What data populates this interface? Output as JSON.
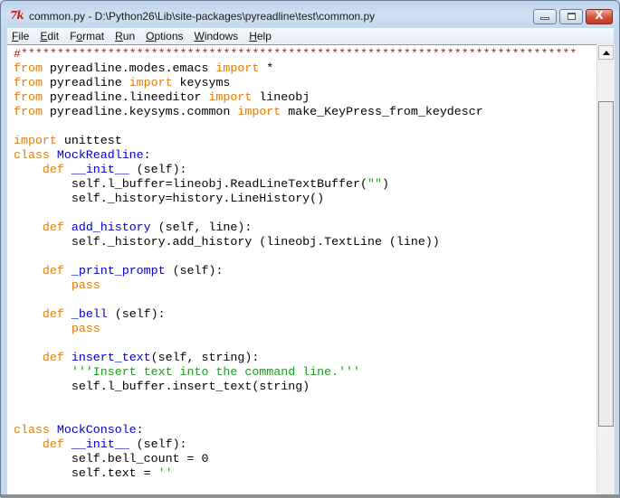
{
  "window": {
    "title": "common.py - D:\\Python26\\Lib\\site-packages\\pyreadline\\test\\common.py",
    "app_icon": "tk-feather-icon",
    "app_icon_text": "7k",
    "controls": {
      "minimize": "minimize-icon",
      "maximize": "maximize-icon",
      "close": "close-icon",
      "close_glyph": "X"
    }
  },
  "menubar": [
    {
      "label": "File",
      "mnemonic": "F",
      "rest": "ile"
    },
    {
      "label": "Edit",
      "mnemonic": "E",
      "rest": "dit"
    },
    {
      "label": "Format",
      "pre": "F",
      "mnemonic": "o",
      "rest": "rmat"
    },
    {
      "label": "Run",
      "mnemonic": "R",
      "rest": "un"
    },
    {
      "label": "Options",
      "mnemonic": "O",
      "rest": "ptions"
    },
    {
      "label": "Windows",
      "mnemonic": "W",
      "rest": "indows"
    },
    {
      "label": "Help",
      "mnemonic": "H",
      "rest": "elp"
    }
  ],
  "syntax_colors": {
    "keyword": "#e07d10",
    "definition": "#0000c8",
    "string": "#1e9b1e",
    "comment": "#c01818",
    "text": "#000000"
  },
  "editor": {
    "lines": [
      [
        [
          "cmt",
          "#*****************************************************************************"
        ]
      ],
      [
        [
          "kw",
          "from"
        ],
        [
          "",
          " pyreadline.modes.emacs "
        ],
        [
          "kw",
          "import"
        ],
        [
          "",
          " *"
        ]
      ],
      [
        [
          "kw",
          "from"
        ],
        [
          "",
          " pyreadline "
        ],
        [
          "kw",
          "import"
        ],
        [
          "",
          " keysyms"
        ]
      ],
      [
        [
          "kw",
          "from"
        ],
        [
          "",
          " pyreadline.lineeditor "
        ],
        [
          "kw",
          "import"
        ],
        [
          "",
          " lineobj"
        ]
      ],
      [
        [
          "kw",
          "from"
        ],
        [
          "",
          " pyreadline.keysyms.common "
        ],
        [
          "kw",
          "import"
        ],
        [
          "",
          " make_KeyPress_from_keydescr"
        ]
      ],
      [
        [
          "",
          ""
        ]
      ],
      [
        [
          "kw",
          "import"
        ],
        [
          "",
          " unittest"
        ]
      ],
      [
        [
          "kw",
          "class"
        ],
        [
          "",
          " "
        ],
        [
          "def",
          "MockReadline"
        ],
        [
          "",
          ":"
        ]
      ],
      [
        [
          "",
          "    "
        ],
        [
          "kw",
          "def"
        ],
        [
          "",
          " "
        ],
        [
          "def",
          "__init__"
        ],
        [
          "",
          " (self):"
        ]
      ],
      [
        [
          "",
          "        self.l_buffer=lineobj.ReadLineTextBuffer("
        ],
        [
          "str",
          "\"\""
        ],
        [
          "",
          ")"
        ]
      ],
      [
        [
          "",
          "        self._history=history.LineHistory()"
        ]
      ],
      [
        [
          "",
          ""
        ]
      ],
      [
        [
          "",
          "    "
        ],
        [
          "kw",
          "def"
        ],
        [
          "",
          " "
        ],
        [
          "def",
          "add_history"
        ],
        [
          "",
          " (self, line):"
        ]
      ],
      [
        [
          "",
          "        self._history.add_history (lineobj.TextLine (line))"
        ]
      ],
      [
        [
          "",
          ""
        ]
      ],
      [
        [
          "",
          "    "
        ],
        [
          "kw",
          "def"
        ],
        [
          "",
          " "
        ],
        [
          "def",
          "_print_prompt"
        ],
        [
          "",
          " (self):"
        ]
      ],
      [
        [
          "",
          "        "
        ],
        [
          "kw",
          "pass"
        ]
      ],
      [
        [
          "",
          ""
        ]
      ],
      [
        [
          "",
          "    "
        ],
        [
          "kw",
          "def"
        ],
        [
          "",
          " "
        ],
        [
          "def",
          "_bell"
        ],
        [
          "",
          " (self):"
        ]
      ],
      [
        [
          "",
          "        "
        ],
        [
          "kw",
          "pass"
        ]
      ],
      [
        [
          "",
          ""
        ]
      ],
      [
        [
          "",
          "    "
        ],
        [
          "kw",
          "def"
        ],
        [
          "",
          " "
        ],
        [
          "def",
          "insert_text"
        ],
        [
          "",
          "(self, string):"
        ]
      ],
      [
        [
          "",
          "        "
        ],
        [
          "str",
          "'''Insert text into the command line.'''"
        ]
      ],
      [
        [
          "",
          "        self.l_buffer.insert_text(string)"
        ]
      ],
      [
        [
          "",
          ""
        ]
      ],
      [
        [
          "",
          ""
        ]
      ],
      [
        [
          "kw",
          "class"
        ],
        [
          "",
          " "
        ],
        [
          "def",
          "MockConsole"
        ],
        [
          "",
          ":"
        ]
      ],
      [
        [
          "",
          "    "
        ],
        [
          "kw",
          "def"
        ],
        [
          "",
          " "
        ],
        [
          "def",
          "__init__"
        ],
        [
          "",
          " (self):"
        ]
      ],
      [
        [
          "",
          "        self.bell_count = 0"
        ]
      ],
      [
        [
          "",
          "        self.text = "
        ],
        [
          "str",
          "''"
        ]
      ]
    ]
  },
  "scrollbar": {
    "up_icon": "scroll-up-arrow-icon",
    "position_fraction": 0.0
  }
}
